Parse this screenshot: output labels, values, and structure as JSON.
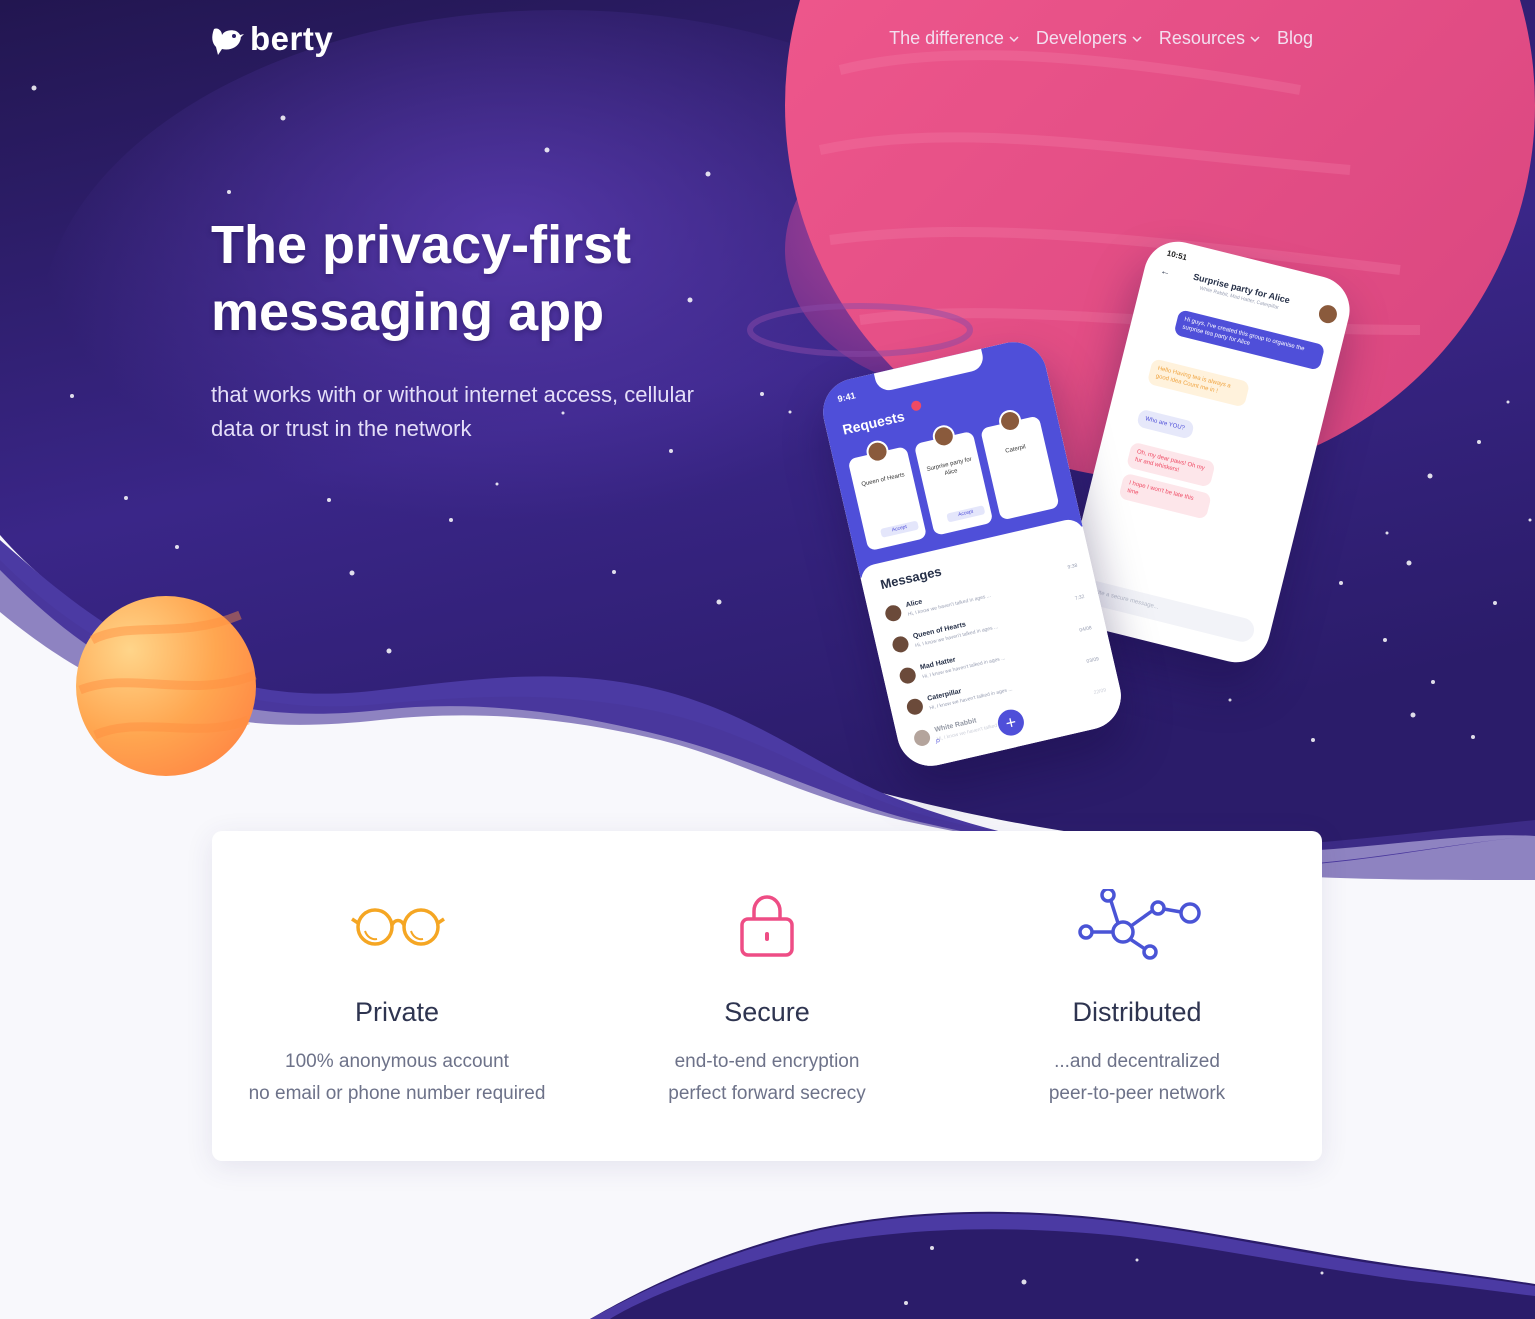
{
  "brand": {
    "name": "berty"
  },
  "nav": {
    "items": [
      {
        "label": "The difference",
        "dropdown": true
      },
      {
        "label": "Developers",
        "dropdown": true
      },
      {
        "label": "Resources",
        "dropdown": true
      },
      {
        "label": "Blog",
        "dropdown": false
      }
    ]
  },
  "hero": {
    "title_line1": "The privacy-first",
    "title_line2": "messaging app",
    "subtitle_line1": "that works with or without internet access, cellular",
    "subtitle_line2": "data or trust in the network"
  },
  "phone_requests": {
    "time": "9:41",
    "requests_label": "Requests",
    "cards": [
      {
        "name": "Queen of Hearts",
        "action": "Accept"
      },
      {
        "name": "Surprise party for Alice",
        "action": "Accept"
      },
      {
        "name": "Caterpil",
        "action": ""
      }
    ],
    "messages_label": "Messages",
    "conversations": [
      {
        "name": "Alice",
        "preview": "Hi, I know we haven't talked in ages ...",
        "time": "9:38"
      },
      {
        "name": "Queen of Hearts",
        "preview": "Hi, I know we haven't talked in ages ...",
        "time": "7:32"
      },
      {
        "name": "Mad Hatter",
        "preview": "Hi, I know we haven't talked in ages ...",
        "time": "04/08"
      },
      {
        "name": "Caterpillar",
        "preview": "Hi, I know we haven't talked in ages ...",
        "time": "03/09"
      },
      {
        "name": "White Rabbit",
        "preview": "Hi, I know we haven't talked in ages ...",
        "time": "22/09"
      }
    ]
  },
  "phone_chat": {
    "time": "10:51",
    "title": "Surprise party for Alice",
    "subtitle": "White Rabbit, Mad Hatter, Caterpillar",
    "messages": [
      {
        "sender": "",
        "text": "Hi guys, I've created this group to organise the surprise tea party for Alice"
      },
      {
        "sender": "Mad Hatter",
        "text": "Hello Having tea is always a good idea Count me in !"
      },
      {
        "sender": "Caterpillar",
        "text": "Who are YOU?"
      },
      {
        "sender": "White Rabbit",
        "text": "Oh, my dear paws! Oh my fur and whiskers!"
      },
      {
        "sender": "",
        "text": "I hope I won't be late this time"
      }
    ],
    "input_placeholder": "Write a secure message..."
  },
  "features": [
    {
      "icon": "glasses-icon",
      "title": "Private",
      "line1": "100% anonymous account",
      "line2": "no email or phone number required",
      "color": "#f5a623"
    },
    {
      "icon": "lock-icon",
      "title": "Secure",
      "line1": "end-to-end encryption",
      "line2": "perfect forward secrecy",
      "color": "#ee4d85"
    },
    {
      "icon": "network-icon",
      "title": "Distributed",
      "line1": "...and decentralized",
      "line2": "peer-to-peer network",
      "color": "#4a54d6"
    }
  ],
  "colors": {
    "space_dark": "#25184f",
    "space_mid": "#3e2a8c",
    "wave_purple": "#4b3aa3",
    "planet_pink": "#ea4c89",
    "planet_orange": "#ff9f4a",
    "accent_blue": "#4f4fd9"
  }
}
